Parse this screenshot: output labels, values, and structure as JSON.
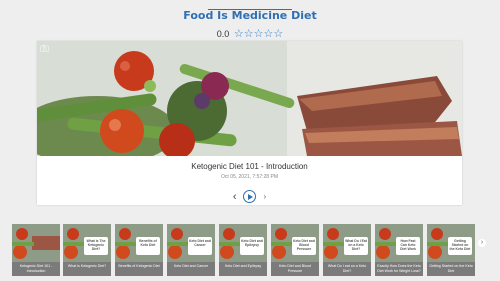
{
  "page": {
    "title": "Food Is Medicine Diet",
    "rating": {
      "score": "0.0",
      "stars": [
        "☆",
        "☆",
        "☆",
        "☆",
        "☆"
      ]
    }
  },
  "video": {
    "title": "Ketogenic Diet 101 - Introduction",
    "date": "Oct 05, 2021, 7:57:28 PM",
    "badge_icon": "camera-icon",
    "controls": {
      "prev": "‹",
      "next": "›"
    }
  },
  "playlist": {
    "prev_arrow": "‹",
    "next_arrow": "›",
    "items": [
      {
        "overlay": "",
        "label": "Ketogenic Diet 101 - Introduction"
      },
      {
        "overlay": "What is The Ketogenic Diet?",
        "label": "What is Ketogenic Diet?"
      },
      {
        "overlay": "Benefits of Keto Diet",
        "label": "Benefits of Ketogenic Diet"
      },
      {
        "overlay": "Keto Diet and Cancer",
        "label": "Keto Diet and Cancer"
      },
      {
        "overlay": "Keto Diet and Epilepsy",
        "label": "Keto Diet and Epilepsy"
      },
      {
        "overlay": "Keto Diet and Blood Pressure",
        "label": "Keto Diet and Blood Pressure"
      },
      {
        "overlay": "What Do I Eat on a Keto Diet?",
        "label": "What Do I eat on a Keto Diet?"
      },
      {
        "overlay": "How Fast Can Keto Diet Work",
        "label": "Exactly How Does the Keto Diet Work for Weight Loss?"
      },
      {
        "overlay": "Getting Started on the Keto Diet",
        "label": "Getting Started on the Keto Diet"
      }
    ]
  },
  "colors": {
    "accent": "#2f6fb3",
    "thumb_label_bg": "#7b7b7b"
  }
}
